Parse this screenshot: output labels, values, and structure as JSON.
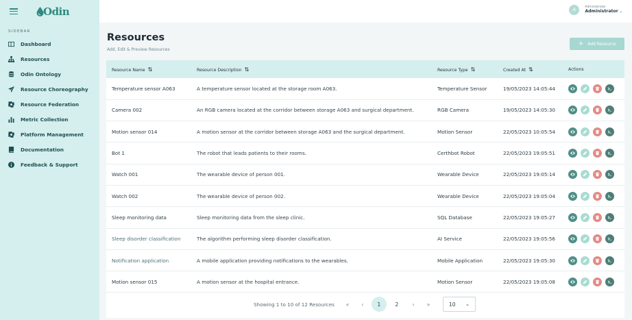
{
  "brand": {
    "name": "Odin"
  },
  "sidebar": {
    "caption": "SIDEBAR",
    "items": [
      {
        "label": "Dashboard",
        "icon": "dashboard-icon"
      },
      {
        "label": "Resources",
        "icon": "sitemap-icon"
      },
      {
        "label": "Odin Ontology",
        "icon": "database-icon"
      },
      {
        "label": "Resource Choreography",
        "icon": "send-icon"
      },
      {
        "label": "Resource Federation",
        "icon": "gear-icon"
      },
      {
        "label": "Metric Collection",
        "icon": "bar-chart-icon"
      },
      {
        "label": "Platform Management",
        "icon": "gear-icon"
      },
      {
        "label": "Documentation",
        "icon": "book-icon"
      },
      {
        "label": "Feedback & Support",
        "icon": "info-icon"
      }
    ]
  },
  "header": {
    "user_role": "Administrator",
    "user_name": "Administrator",
    "avatar_initial": "A"
  },
  "main": {
    "title": "Resources",
    "subtitle": "Add, Edit & Preview Resources",
    "add_button": "Add Resource"
  },
  "table": {
    "columns": [
      {
        "label": "Resource Name",
        "sortable": true
      },
      {
        "label": "Resource Description",
        "sortable": true
      },
      {
        "label": "Resource Type",
        "sortable": true
      },
      {
        "label": "Created At",
        "sortable": true
      },
      {
        "label": "Actions",
        "sortable": false
      }
    ],
    "rows": [
      {
        "name": "Temperature sensor A063",
        "description": "A temperature sensor located at the storage room A063.",
        "type": "Temperature Sensor",
        "created": "19/05/2023 14:05:44"
      },
      {
        "name": "Camera 002",
        "description": "An RGB camera located at the corridor between storage A063 and surgical department.",
        "type": "RGB Camera",
        "created": "19/05/2023 14:05:30"
      },
      {
        "name": "Motion sensor 014",
        "description": "A motion sensor at the corridor between storage A063 and the surgical department.",
        "type": "Motion Sensor",
        "created": "22/05/2023 10:05:54"
      },
      {
        "name": "Bot 1",
        "description": "The robot that leads patients to their rooms.",
        "type": "Certhbot Robot",
        "created": "22/05/2023 19:05:51"
      },
      {
        "name": "Watch 001",
        "description": "The wearable device of person 001.",
        "type": "Wearable Device",
        "created": "22/05/2023 19:05:14"
      },
      {
        "name": "Watch 002",
        "description": "The wearable device of person 002.",
        "type": "Wearable Device",
        "created": "22/05/2023 19:05:04"
      },
      {
        "name": "Sleep monitoring data",
        "description": "Sleep monitoring data from the sleep clinic.",
        "type": "SQL Database",
        "created": "22/05/2023 19:05:27"
      },
      {
        "name": "Sleep disorder classification",
        "description": "The algorithm performing sleep disorder classification.",
        "type": "AI Service",
        "created": "22/05/2023 19:05:56"
      },
      {
        "name": "Notification application",
        "description": "A mobile application providing notifications to the wearables.",
        "type": "Mobile Application",
        "created": "22/05/2023 19:05:30"
      },
      {
        "name": "Motion sensor 015",
        "description": "A motion sensor at the hospital entrance.",
        "type": "Motion Sensor",
        "created": "22/05/2023 19:05:08"
      }
    ]
  },
  "pagination": {
    "summary": "Showing 1 to 10 of 12 Resources",
    "first": "«",
    "prev": "‹",
    "pages": [
      "1",
      "2"
    ],
    "current": "1",
    "next": "›",
    "last": "»",
    "page_size": "10"
  },
  "colors": {
    "sidebar_bg": "#d4efed",
    "accent": "#2f8a80",
    "view": "#4f8f87",
    "edit": "#a8dcd2",
    "delete": "#e18b86",
    "terminal": "#4d7e77"
  }
}
